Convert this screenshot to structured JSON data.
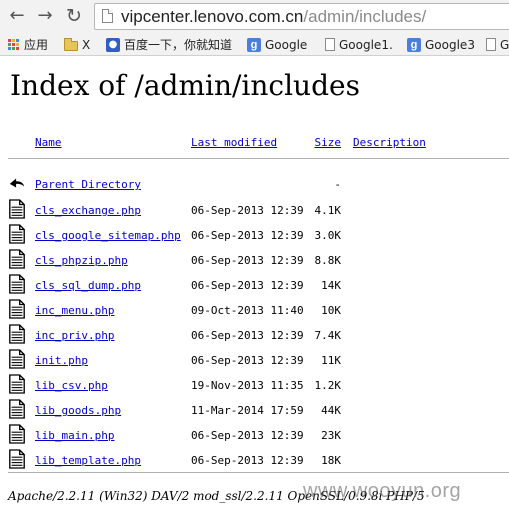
{
  "browser": {
    "url_host": "vipcenter.lenovo.com.cn",
    "url_path": "/admin/includes/",
    "bookmarks": [
      {
        "label": "应用",
        "icon": "apps-grid-icon"
      },
      {
        "label": "X",
        "icon": "folder-icon"
      },
      {
        "label": "百度一下，你就知道",
        "icon": "baidu-paw-icon"
      },
      {
        "label": "Google",
        "icon": "google-g-icon"
      },
      {
        "label": "Google1.",
        "icon": "document-icon"
      },
      {
        "label": "Google3",
        "icon": "google-g-icon"
      },
      {
        "label": "G",
        "icon": "document-icon"
      }
    ]
  },
  "page": {
    "title": "Index of /admin/includes",
    "headers": {
      "name": "Name",
      "last_modified": "Last modified",
      "size": "Size",
      "description": "Description"
    },
    "parent": {
      "label": "Parent Directory",
      "size": "-",
      "icon": "back-arrow-icon"
    },
    "files": [
      {
        "name": "cls_exchange.php",
        "date": "06-Sep-2013 12:39",
        "size": "4.1K"
      },
      {
        "name": "cls_google_sitemap.php",
        "date": "06-Sep-2013 12:39",
        "size": "3.0K"
      },
      {
        "name": "cls_phpzip.php",
        "date": "06-Sep-2013 12:39",
        "size": "8.8K"
      },
      {
        "name": "cls_sql_dump.php",
        "date": "06-Sep-2013 12:39",
        "size": "14K"
      },
      {
        "name": "inc_menu.php",
        "date": "09-Oct-2013 11:40",
        "size": "10K"
      },
      {
        "name": "inc_priv.php",
        "date": "06-Sep-2013 12:39",
        "size": "7.4K"
      },
      {
        "name": "init.php",
        "date": "06-Sep-2013 12:39",
        "size": "11K"
      },
      {
        "name": "lib_csv.php",
        "date": "19-Nov-2013 11:35",
        "size": "1.2K"
      },
      {
        "name": "lib_goods.php",
        "date": "11-Mar-2014 17:59",
        "size": "44K"
      },
      {
        "name": "lib_main.php",
        "date": "06-Sep-2013 12:39",
        "size": "23K"
      },
      {
        "name": "lib_template.php",
        "date": "06-Sep-2013 12:39",
        "size": "18K"
      }
    ],
    "footer": "Apache/2.2.11 (Win32) DAV/2 mod_ssl/2.2.11 OpenSSL/0.9.8i PHP/5",
    "watermark": "www.wooyun.org"
  },
  "colors": {
    "link": "#0000cc",
    "chrome_bg": "#f2f2f2",
    "url_path": "#8a8a8a"
  }
}
